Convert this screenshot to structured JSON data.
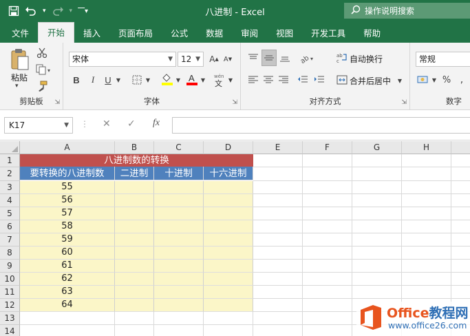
{
  "window": {
    "title": "八进制 - Excel",
    "tellme": "操作说明搜索"
  },
  "colors": {
    "brand": "#217346",
    "title_fill": "#c0504d",
    "header_fill": "#4f81bd",
    "data_fill": "#fbf6c8"
  },
  "qat": {
    "save_icon": "save-icon",
    "undo_icon": "undo-icon",
    "redo_icon": "redo-icon",
    "customize_icon": "customize-qat-icon"
  },
  "tabs": [
    "文件",
    "开始",
    "插入",
    "页面布局",
    "公式",
    "数据",
    "审阅",
    "视图",
    "开发工具",
    "帮助"
  ],
  "active_tab": "开始",
  "ribbon": {
    "clipboard": {
      "label": "剪贴板",
      "paste": "粘贴"
    },
    "font": {
      "label": "字体",
      "font_name": "宋体",
      "font_size": "12",
      "bold": "B",
      "italic": "I",
      "underline": "U"
    },
    "alignment": {
      "label": "对齐方式",
      "wrap": "自动换行",
      "merge": "合并后居中"
    },
    "number": {
      "label": "数字",
      "format": "常规",
      "percent": "%"
    }
  },
  "formula_bar": {
    "name_box": "K17",
    "fx": "fx",
    "value": ""
  },
  "columns": [
    "A",
    "B",
    "C",
    "D",
    "E",
    "F",
    "G",
    "H"
  ],
  "rows": [
    "1",
    "2",
    "3",
    "4",
    "5",
    "6",
    "7",
    "8",
    "9",
    "10",
    "11",
    "12",
    "13",
    "14"
  ],
  "sheet": {
    "title": "八进制数的转换",
    "headers": [
      "要转换的八进制数",
      "二进制",
      "十进制",
      "十六进制"
    ],
    "values": [
      "55",
      "56",
      "57",
      "58",
      "59",
      "60",
      "61",
      "62",
      "63",
      "64"
    ]
  },
  "watermark": {
    "brand_a": "Office",
    "brand_b": "教程网",
    "url": "www.office26.com"
  }
}
